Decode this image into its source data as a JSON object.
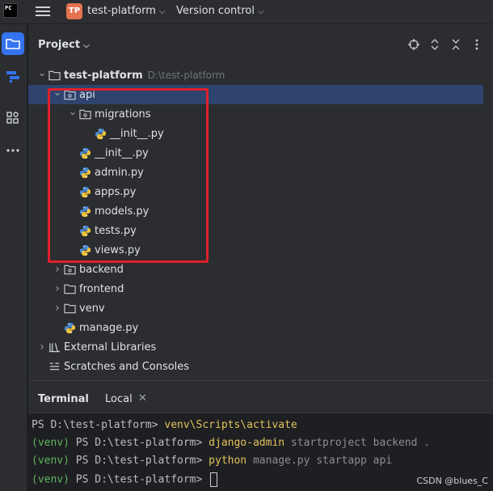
{
  "titlebar": {
    "app_logo": "PC",
    "project_badge": "TP",
    "project_name": "test-platform",
    "vc_label": "Version control"
  },
  "colors": {
    "badge": "#e3734f",
    "python_blue": "#4b8bd5",
    "python_yellow": "#f0c43c",
    "selection": "#2e436e",
    "highlight_box": "#e0202a"
  },
  "project_panel": {
    "title": "Project",
    "actions": [
      "target-icon",
      "expand-collapse-icon",
      "collapse-all-icon",
      "more-icon"
    ],
    "tree": [
      {
        "label": "test-platform",
        "hint": "D:\\test-platform",
        "type": "folder",
        "expanded": true,
        "bold": true
      },
      {
        "label": "api",
        "type": "package",
        "expanded": true,
        "selected": true
      },
      {
        "label": "migrations",
        "type": "package",
        "expanded": true
      },
      {
        "label": "__init__.py",
        "type": "python"
      },
      {
        "label": "__init__.py",
        "type": "python"
      },
      {
        "label": "admin.py",
        "type": "python"
      },
      {
        "label": "apps.py",
        "type": "python"
      },
      {
        "label": "models.py",
        "type": "python"
      },
      {
        "label": "tests.py",
        "type": "python"
      },
      {
        "label": "views.py",
        "type": "python"
      },
      {
        "label": "backend",
        "type": "package",
        "expanded": false
      },
      {
        "label": "frontend",
        "type": "folder",
        "expanded": false
      },
      {
        "label": "venv",
        "type": "folder",
        "expanded": false
      },
      {
        "label": "manage.py",
        "type": "python"
      },
      {
        "label": "External Libraries",
        "type": "library",
        "expanded": false
      },
      {
        "label": "Scratches and Consoles",
        "type": "scratches"
      }
    ]
  },
  "terminal": {
    "title": "Terminal",
    "tab": "Local",
    "lines": [
      {
        "venv": "",
        "prompt": "PS D:\\test-platform> ",
        "cmd": "venv\\Scripts\\activate",
        "args": ""
      },
      {
        "venv": "(venv) ",
        "prompt": "PS D:\\test-platform> ",
        "cmd": "django-admin",
        "args": " startproject backend ."
      },
      {
        "venv": "(venv) ",
        "prompt": "PS D:\\test-platform> ",
        "cmd": "python",
        "args": " manage.py startapp api"
      },
      {
        "venv": "(venv) ",
        "prompt": "PS D:\\test-platform> ",
        "cmd": "",
        "args": ""
      }
    ]
  },
  "watermark": "CSDN @blues_C"
}
